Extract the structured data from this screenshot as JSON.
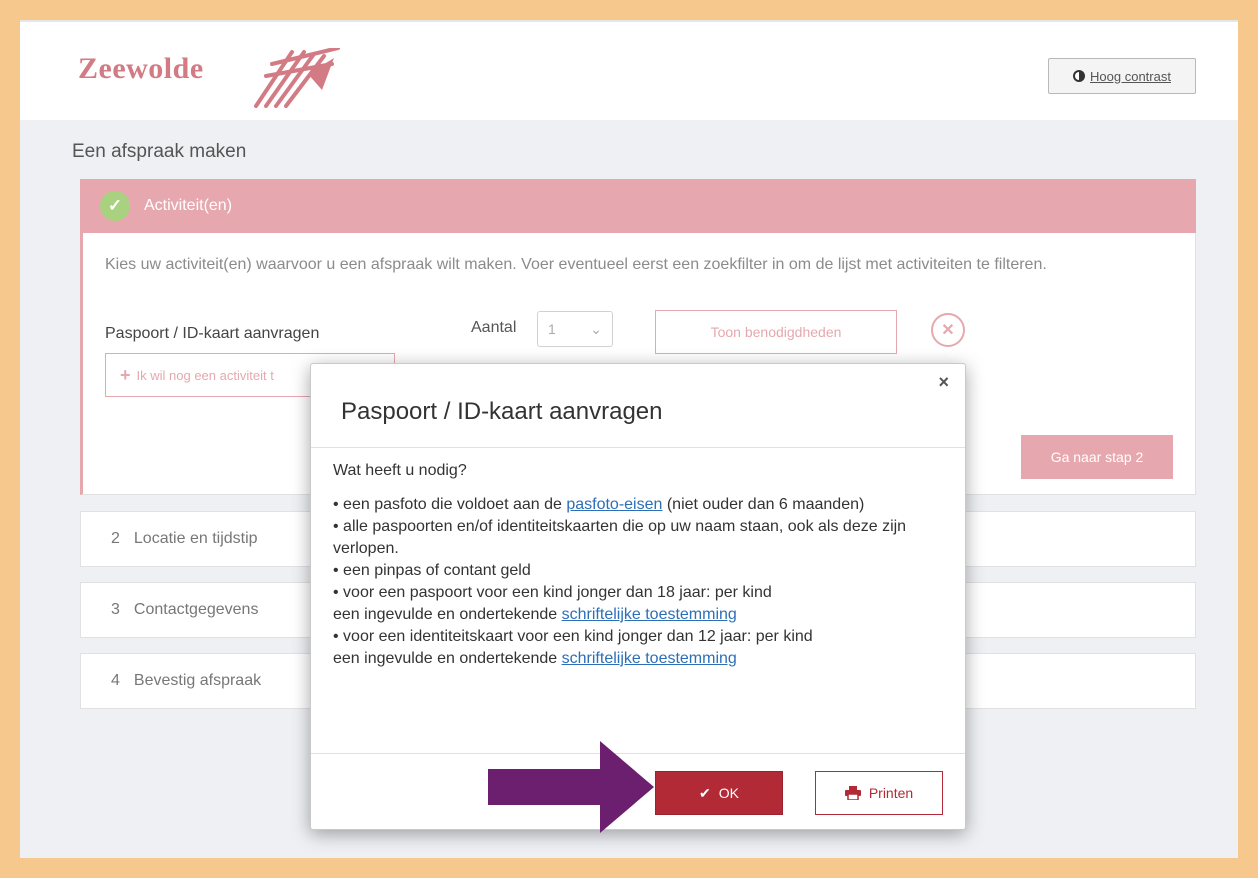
{
  "header": {
    "logo_text": "Zeewolde",
    "contrast_label": "Hoog contrast"
  },
  "page": {
    "heading": "Een afspraak maken"
  },
  "step1": {
    "title": "Activiteit(en)",
    "intro": "Kies uw activiteit(en) waarvoor u een afspraak wilt maken. Voer eventueel eerst een zoekfilter in om de lijst met activiteiten te filteren.",
    "activity_label": "Paspoort / ID-kaart aanvragen",
    "aantal_label": "Aantal",
    "aantal_value": "1",
    "toon_label": "Toon benodigdheden",
    "add_label": "Ik wil nog een activiteit t",
    "next_label": "Ga naar stap 2"
  },
  "steps": [
    {
      "number": "2",
      "label": "Locatie en tijdstip"
    },
    {
      "number": "3",
      "label": "Contactgegevens"
    },
    {
      "number": "4",
      "label": "Bevestig afspraak"
    }
  ],
  "modal": {
    "close": "×",
    "title": "Paspoort / ID-kaart aanvragen",
    "question": "Wat heeft u nodig?",
    "item1_pre": "•  een pasfoto die voldoet aan de ",
    "item1_link": "pasfoto-eisen",
    "item1_post": " (niet ouder dan 6 maanden)",
    "item2": "•  alle paspoorten en/of identiteitskaarten die op uw naam staan, ook als deze zijn verlopen.",
    "item3": "•  een pinpas of contant geld",
    "item4_line1": "•  voor een paspoort voor een kind jonger dan 18 jaar: per kind",
    "item4_pre": "een ingevulde en ondertekende ",
    "item4_link": "schriftelijke toestemming",
    "item5_line1": "•  voor een identiteitskaart voor een kind jonger dan 12 jaar: per kind",
    "item5_pre": "een ingevulde en ondertekende ",
    "item5_link": "schriftelijke toestemming",
    "ok_label": "OK",
    "print_label": "Printen"
  },
  "colors": {
    "page_border": "#f7c88e",
    "brand_pink": "#e6a8ae",
    "ok_red": "#b12a36",
    "arrow_purple": "#6b1f6e",
    "check_green": "#a8d27f"
  }
}
